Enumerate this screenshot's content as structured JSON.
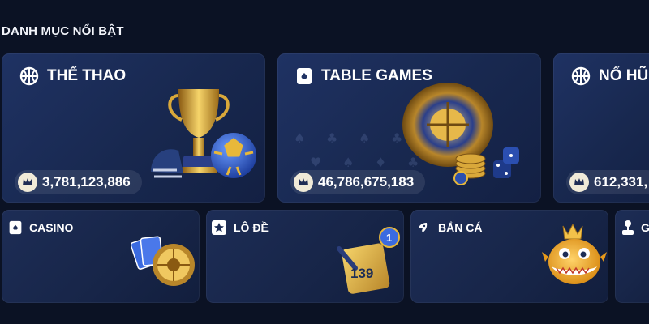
{
  "section": {
    "title": "DANH MỤC NỔI BẬT"
  },
  "featured": [
    {
      "label": "THỂ THAO",
      "icon": "basketball-icon",
      "jackpot": "3,781,123,886"
    },
    {
      "label": "TABLE GAMES",
      "icon": "playing-card-icon",
      "jackpot": "46,786,675,183"
    },
    {
      "label": "NỔ HŨ",
      "icon": "basketball-icon",
      "jackpot": "612,331,"
    }
  ],
  "categories": [
    {
      "label": "CASINO",
      "icon": "playing-card-icon"
    },
    {
      "label": "LÔ ĐỀ",
      "icon": "star-card-icon"
    },
    {
      "label": "BẮN CÁ",
      "icon": "fish-icon"
    },
    {
      "label": "G",
      "icon": "joystick-icon"
    }
  ],
  "lottery_art_number": "139",
  "colors": {
    "background": "#0b1224",
    "card": "#1b2c58",
    "gold": "#e8b83a",
    "blue_ball": "#2a5bd7"
  }
}
